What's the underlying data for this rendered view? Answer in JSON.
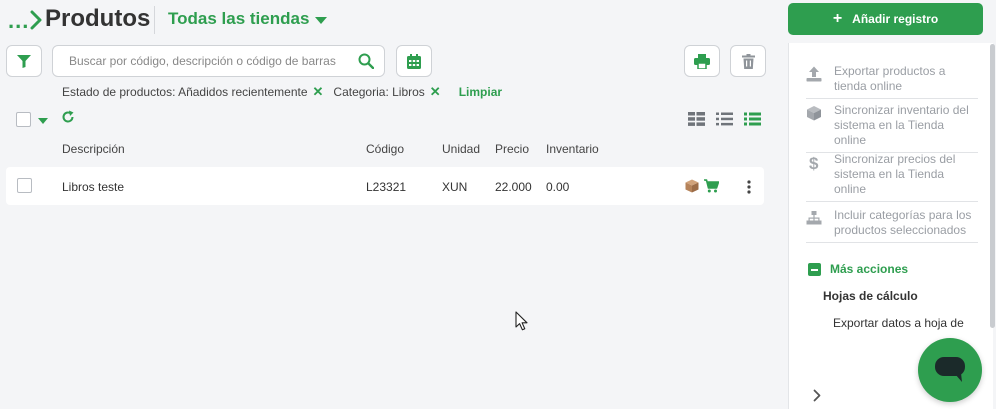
{
  "header": {
    "breadcrumb_dots": "...",
    "title": "Produtos",
    "store_select": "Todas las tiendas",
    "add_button": "Añadir registro"
  },
  "toolbar": {
    "search_placeholder": "Buscar por código, descripción o código de barras"
  },
  "filters": {
    "chips": [
      {
        "label": "Estado de productos: Añadidos recientemente",
        "remove": "✕"
      },
      {
        "label": "Categoria: Libros",
        "remove": "✕"
      }
    ],
    "clear": "Limpiar"
  },
  "table": {
    "columns": [
      "Descripción",
      "Código",
      "Unidad",
      "Precio",
      "Inventario"
    ],
    "rows": [
      {
        "description": "Libros teste",
        "code": "L23321",
        "unit": "XUN",
        "price": "22.000",
        "inventory": "0.00"
      }
    ]
  },
  "side_panel": {
    "items": [
      {
        "icon": "upload-icon",
        "label": "Exportar productos a tienda online"
      },
      {
        "icon": "box-icon",
        "label": "Sincronizar inventario del sistema en la Tienda online"
      },
      {
        "icon": "dollar-icon",
        "label": "Sincronizar precios del sistema en la Tienda online"
      },
      {
        "icon": "sitemap-icon",
        "label": "Incluir categorías para los productos seleccionados"
      }
    ],
    "more_actions": "Más acciones",
    "sheets_title": "Hojas de cálculo",
    "sheets_export": "Exportar datos a hoja de"
  },
  "colors": {
    "accent": "#2e9e4f",
    "background": "#f4f5f7",
    "box_icon": "#b5835a"
  }
}
